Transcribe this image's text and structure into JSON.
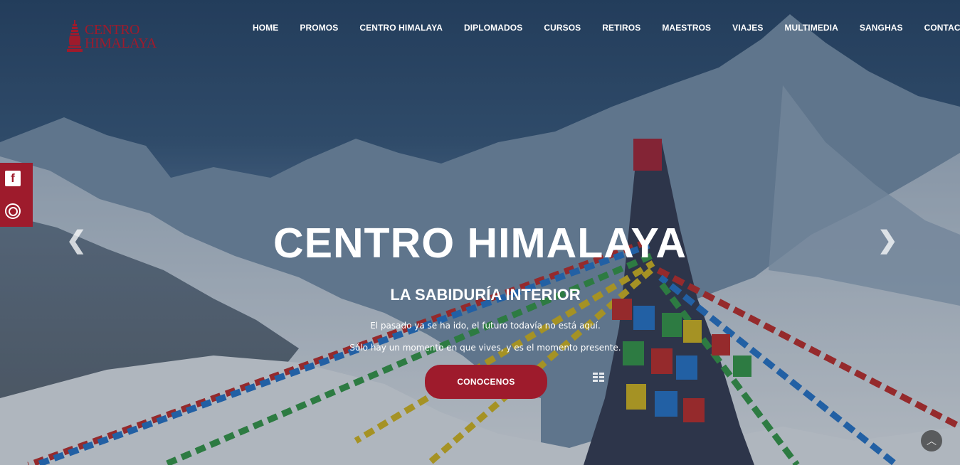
{
  "header": {
    "logo_line1": "CENTRO",
    "logo_line2": "HIMALAYA",
    "brand_color": "#9e1b2c"
  },
  "nav": {
    "items": [
      "HOME",
      "PROMOS",
      "CENTRO HIMALAYA",
      "DIPLOMADOS",
      "CURSOS",
      "RETIROS",
      "MAESTROS",
      "VIAJES",
      "MULTIMEDIA",
      "SANGHAS",
      "CONTACTO"
    ]
  },
  "social": {
    "facebook_icon": "facebook-icon",
    "instagram_icon": "instagram-icon"
  },
  "slider": {
    "title": "CENTRO HIMALAYA",
    "subtitle": "LA SABIDURÍA INTERIOR",
    "line1": "El pasado ya se ha ido, el futuro todavía no está aquí.",
    "line2": "Sólo hay un momento en que vives, y es el momento presente.",
    "cta_label": "CONOCENOS",
    "prev_icon": "chevron-left-icon",
    "next_icon": "chevron-right-icon",
    "prev_glyph": "❮",
    "next_glyph": "❯"
  },
  "scroll_top": {
    "icon": "chevron-up-icon",
    "glyph": "︿"
  }
}
